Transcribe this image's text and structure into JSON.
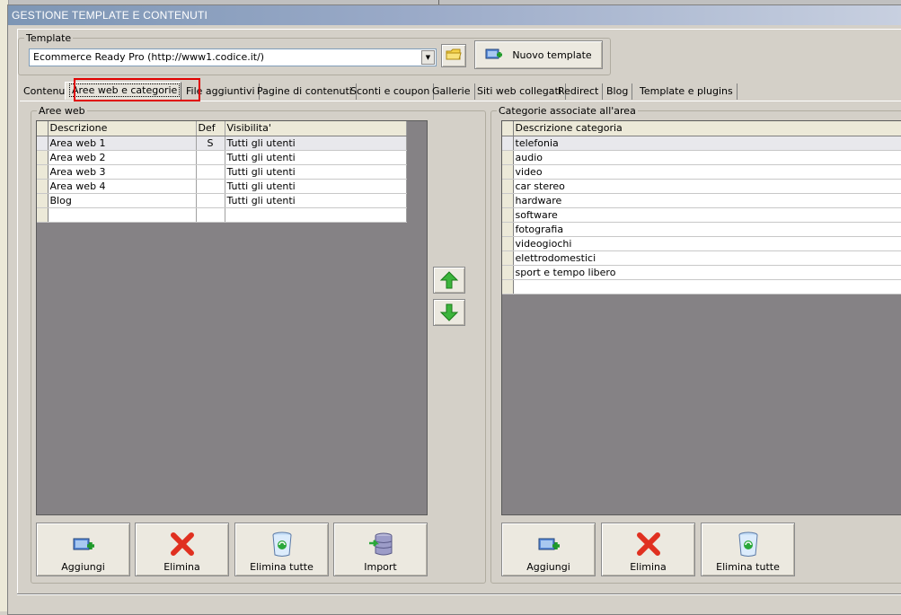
{
  "window": {
    "title": "GESTIONE TEMPLATE E CONTENUTI"
  },
  "template_group": {
    "legend": "Template",
    "selected": "Ecommerce Ready Pro (http://www1.codice.it/)",
    "new_button": "Nuovo template",
    "icons": {
      "folder": "folder-icon",
      "new": "new-template-icon"
    }
  },
  "tabs": [
    "Contenuti",
    "Aree web e categorie",
    "File aggiuntivi",
    "Pagine di contenuti",
    "Sconti e coupon",
    "Gallerie",
    "Siti web collegati",
    "Redirect",
    "Blog",
    "Template e plugins"
  ],
  "active_tab": "Aree web e categorie",
  "aree_web": {
    "legend": "Aree web",
    "columns": [
      "Descrizione",
      "Def",
      "Visibilita'"
    ],
    "rows": [
      {
        "descrizione": "Area web 1",
        "def": "S",
        "visibilita": "Tutti gli utenti"
      },
      {
        "descrizione": "Area web 2",
        "def": "",
        "visibilita": "Tutti gli utenti"
      },
      {
        "descrizione": "Area web 3",
        "def": "",
        "visibilita": "Tutti gli utenti"
      },
      {
        "descrizione": "Area web 4",
        "def": "",
        "visibilita": "Tutti gli utenti"
      },
      {
        "descrizione": "Blog",
        "def": "",
        "visibilita": "Tutti gli utenti"
      }
    ],
    "buttons": {
      "add": "Aggiungi",
      "delete": "Elimina",
      "delete_all": "Elimina tutte",
      "import": "Import"
    }
  },
  "categorie": {
    "legend": "Categorie associate all'area",
    "columns": [
      "Descrizione categoria"
    ],
    "rows": [
      "telefonia",
      "audio",
      "video",
      "car stereo",
      "hardware",
      "software",
      "fotografia",
      "videogiochi",
      "elettrodomestici",
      "sport e tempo libero"
    ],
    "buttons": {
      "add": "Aggiungi",
      "delete": "Elimina",
      "delete_all": "Elimina tutte"
    }
  },
  "colors": {
    "title_gradient_start": "#7d96b5",
    "grid_background": "#858285",
    "highlight": "#e00000",
    "arrow_green": "#3cb43c",
    "delete_red": "#e03020"
  }
}
